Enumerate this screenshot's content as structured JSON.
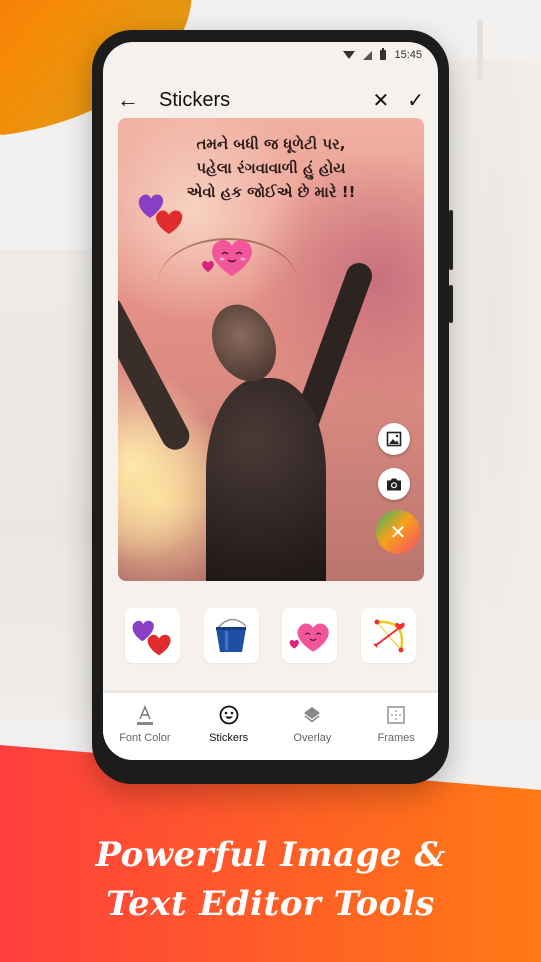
{
  "status_bar": {
    "time": "15:45"
  },
  "app_bar": {
    "title": "Stickers",
    "back_icon": "arrow-left-icon",
    "close_icon": "close-icon",
    "confirm_icon": "check-icon"
  },
  "canvas": {
    "quote_lines": [
      "તમને બધી જ ધૂળેટી પર,",
      "પહેલા રંગવાવાળી હું હોય",
      "એવો હક જોઈએ છે મારે !!"
    ],
    "placed_stickers": [
      "two-hearts-sticker",
      "smiling-heart-sticker"
    ],
    "actions": [
      {
        "name": "gallery",
        "icon": "image-icon"
      },
      {
        "name": "camera",
        "icon": "camera-icon"
      },
      {
        "name": "close",
        "icon": "close-icon",
        "symbol": "✕"
      }
    ]
  },
  "sticker_tray": [
    {
      "name": "two-hearts",
      "icon": "two-hearts-icon"
    },
    {
      "name": "blue-bucket",
      "icon": "bucket-icon"
    },
    {
      "name": "smiling-heart",
      "icon": "smiling-heart-icon"
    },
    {
      "name": "cupid-bow",
      "icon": "bow-arrow-icon"
    }
  ],
  "bottom_nav": [
    {
      "label": "Font Color",
      "icon": "font-color-icon",
      "active": false
    },
    {
      "label": "Stickers",
      "icon": "smiley-icon",
      "active": true
    },
    {
      "label": "Overlay",
      "icon": "layers-icon",
      "active": false
    },
    {
      "label": "Frames",
      "icon": "frame-icon",
      "active": false
    }
  ],
  "banner": {
    "line1": "Powerful Image &",
    "line2": "Text Editor Tools"
  },
  "colors": {
    "banner_start": "#ff3e3e",
    "banner_end": "#ff7a14",
    "blob_orange": "#f58b07",
    "screen_bg": "#f7f1ee"
  }
}
